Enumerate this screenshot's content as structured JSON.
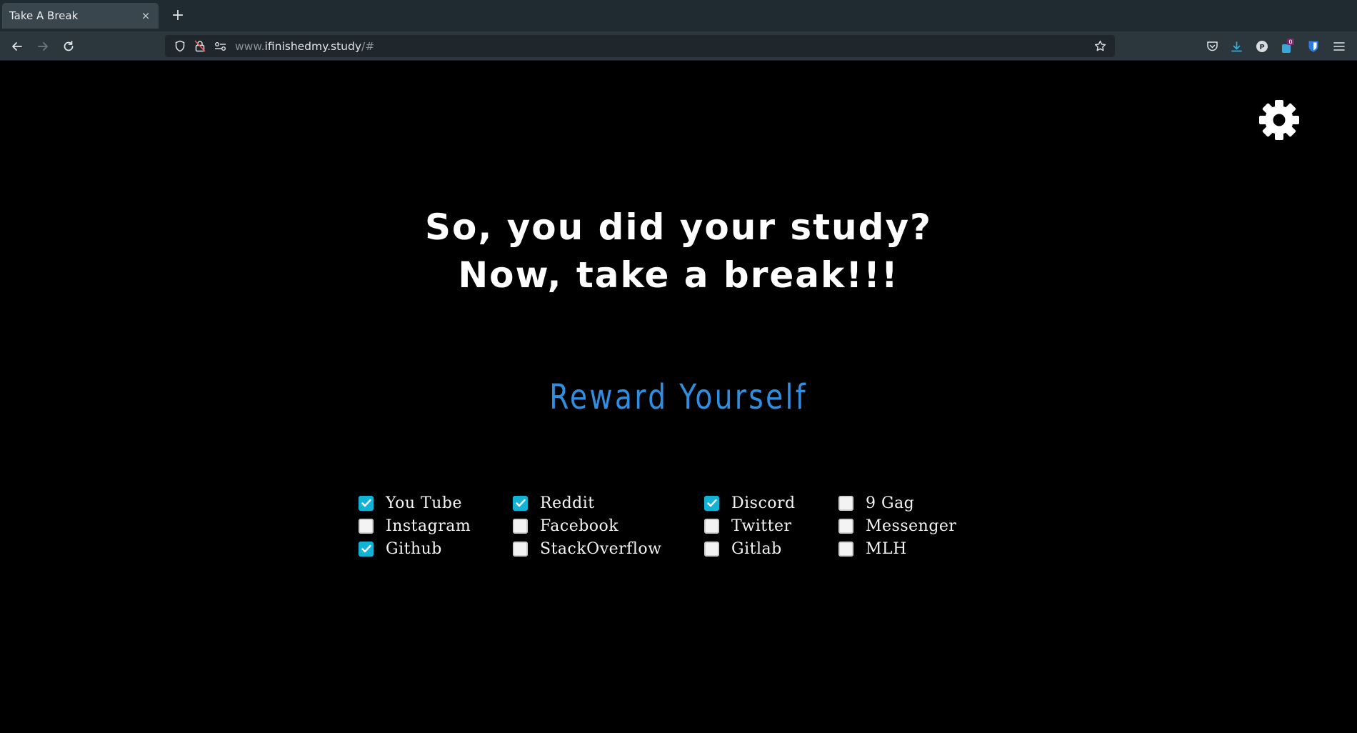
{
  "browser": {
    "tab_title": "Take A Break",
    "tab_close": "×",
    "new_tab": "+",
    "url_prefix": "www.",
    "url_host": "ifinishedmy.study",
    "url_suffix": "/#",
    "badge_count": "0"
  },
  "page": {
    "headline_line1": "So, you did your study?",
    "headline_line2": "Now, take a break!!!",
    "reward_label": "Reward Yourself",
    "accent_color": "#2f8ee0",
    "checkbox_color": "#13b3d8",
    "sites": [
      {
        "label": "You Tube",
        "checked": true
      },
      {
        "label": "Instagram",
        "checked": false
      },
      {
        "label": "Github",
        "checked": true
      },
      {
        "label": "Reddit",
        "checked": true
      },
      {
        "label": "Facebook",
        "checked": false
      },
      {
        "label": "StackOverflow",
        "checked": false
      },
      {
        "label": "Discord",
        "checked": true
      },
      {
        "label": "Twitter",
        "checked": false
      },
      {
        "label": "Gitlab",
        "checked": false
      },
      {
        "label": "9 Gag",
        "checked": false
      },
      {
        "label": "Messenger",
        "checked": false
      },
      {
        "label": "MLH",
        "checked": false
      }
    ]
  }
}
